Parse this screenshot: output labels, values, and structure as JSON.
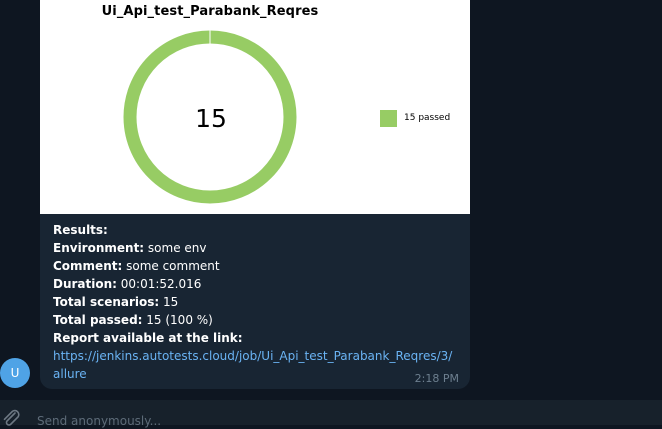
{
  "colors": {
    "background": "#0e1621",
    "bubble": "#182533",
    "passed": "#97cc64",
    "link": "#6ab3f3",
    "avatar": "#4fa3e6"
  },
  "chart_data": {
    "type": "pie",
    "title": "Ui_Api_test_Parabank_Reqres",
    "center_label": "15",
    "categories": [
      "passed"
    ],
    "values": [
      15
    ],
    "legend": [
      "15 passed"
    ],
    "legend_position": "right"
  },
  "message": {
    "results_label": "Results:",
    "environment_label": "Environment:",
    "environment_value": " some env",
    "comment_label": "Comment:",
    "comment_value": " some comment",
    "duration_label": "Duration:",
    "duration_value": " 00:01:52.016",
    "total_scenarios_label": "Total scenarios:",
    "total_scenarios_value": " 15",
    "total_passed_label": "Total passed:",
    "total_passed_value": " 15 (100 %)",
    "report_label": "Report available at the link:",
    "report_link": "https://jenkins.autotests.cloud/job/Ui_Api_test_Parabank_Reqres/3/allure",
    "time": "2:18 PM"
  },
  "sender": {
    "avatar_letter": "U"
  },
  "composer": {
    "placeholder": "Send anonymously..."
  }
}
